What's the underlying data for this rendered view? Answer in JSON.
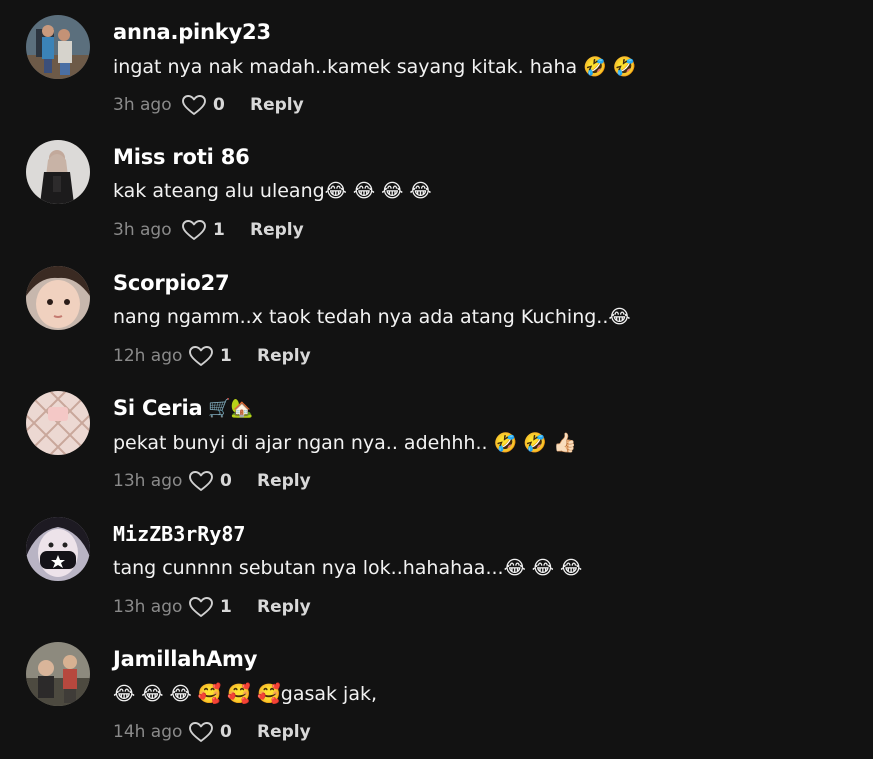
{
  "colors": {
    "background": "#121212",
    "username": "#ffffff",
    "meta": "#8a8a8a",
    "action": "#d8d8d8"
  },
  "icons": {
    "like": "heart-outline-icon"
  },
  "comments": [
    {
      "username": "anna.pinky23",
      "text": "ingat nya nak madah..kamek sayang kitak. haha 🤣 🤣",
      "time": "3h ago",
      "likes": "0",
      "reply": "Reply"
    },
    {
      "username": "Miss roti 86",
      "text": "kak ateang alu uleang😂 😂 😂 😂",
      "time": "3h ago",
      "likes": "1",
      "reply": "Reply"
    },
    {
      "username": "Scorpio27",
      "text": "nang ngamm..x taok tedah nya ada atang Kuching..😂",
      "time": "12h ago",
      "likes": "1",
      "reply": "Reply"
    },
    {
      "username": "Si Ceria",
      "badges": "🛒🏡",
      "text": "pekat bunyi di ajar ngan nya.. adehhh.. 🤣 🤣 👍🏻",
      "time": "13h ago",
      "likes": "0",
      "reply": "Reply"
    },
    {
      "username": "MizZB3rRy87",
      "text": "tang cunnnn sebutan nya lok..hahahaa...😂 😂 😂",
      "time": "13h ago",
      "likes": "1",
      "reply": "Reply"
    },
    {
      "username": "JamillahAmy",
      "text": "😂 😂 😂 🥰 🥰 🥰gasak jak,",
      "time": "14h ago",
      "likes": "0",
      "reply": "Reply"
    }
  ]
}
